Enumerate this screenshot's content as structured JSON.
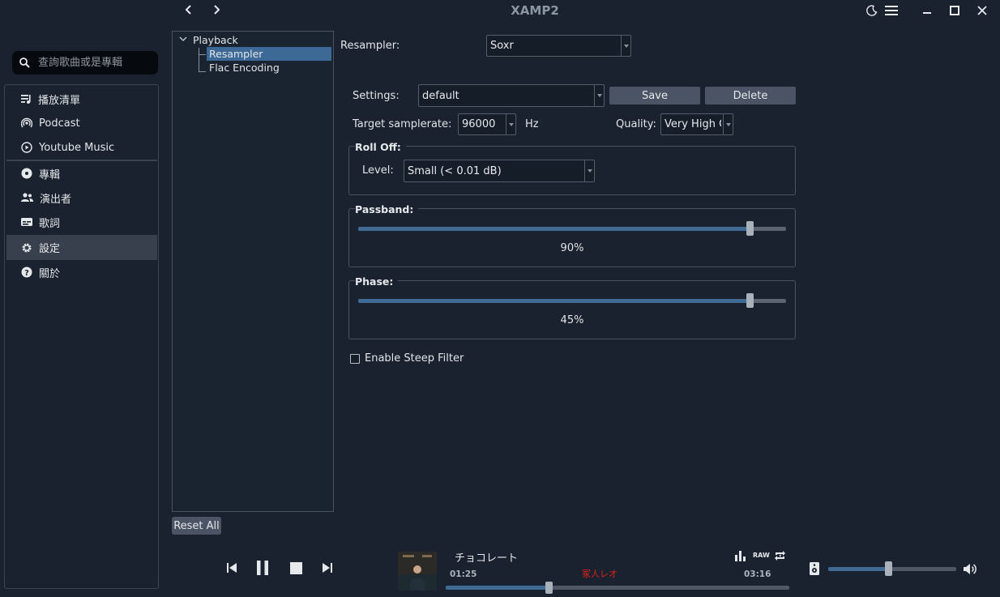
{
  "window": {
    "title": "XAMP2",
    "back_icon": "chevron-left-icon",
    "forward_icon": "chevron-right-icon",
    "theme_icon": "moon-icon",
    "menu_icon": "hamburger-icon",
    "minimize_icon": "minimize-icon",
    "maximize_icon": "maximize-icon",
    "close_icon": "close-icon"
  },
  "sidebar": {
    "search_placeholder": "查詢歌曲或是專輯",
    "items": [
      {
        "label": "播放清單",
        "icon": "playlist-icon"
      },
      {
        "label": "Podcast",
        "icon": "podcast-icon"
      },
      {
        "label": "Youtube Music",
        "icon": "play-circle-icon"
      },
      {
        "label": "專輯",
        "icon": "disc-icon"
      },
      {
        "label": "演出者",
        "icon": "people-icon"
      },
      {
        "label": "歌詞",
        "icon": "subtitles-icon"
      },
      {
        "label": "設定",
        "icon": "gear-icon",
        "active": true
      },
      {
        "label": "關於",
        "icon": "help-icon"
      }
    ]
  },
  "tree": {
    "root": "Playback",
    "children": [
      "Resampler",
      "Flac Encoding"
    ],
    "selected": "Resampler",
    "reset_label": "Reset All"
  },
  "resampler": {
    "label": "Resampler:",
    "value": "Soxr",
    "settings_label": "Settings:",
    "settings_value": "default",
    "save_label": "Save",
    "delete_label": "Delete",
    "samplerate_label": "Target samplerate:",
    "samplerate_value": "96000",
    "samplerate_unit": "Hz",
    "quality_label": "Quality:",
    "quality_value": "Very High Q",
    "rolloff_title": "Roll Off:",
    "level_label": "Level:",
    "level_value": "Small (< 0.01 dB)",
    "passband_title": "Passband:",
    "passband_value": 90,
    "passband_text": "90%",
    "phase_title": "Phase:",
    "phase_value": 45,
    "phase_text": "45%",
    "steep_filter_label": "Enable Steep Filter",
    "steep_filter_checked": false
  },
  "player": {
    "prev_icon": "skip-previous-icon",
    "pause_icon": "pause-icon",
    "stop_icon": "stop-icon",
    "next_icon": "skip-next-icon",
    "track_title": "チョコレート",
    "artist": "冢人レオ",
    "elapsed": "01:25",
    "duration": "03:16",
    "progress": 0.3,
    "eq_icon": "equalizer-icon",
    "raw_label": "RAW",
    "repeat_icon": "repeat-one-icon",
    "speaker_icon": "speaker-icon",
    "volume": 0.47,
    "volume_icon": "volume-icon",
    "colors": {
      "artist": "#e0201d",
      "accent": "#3d6996"
    }
  }
}
